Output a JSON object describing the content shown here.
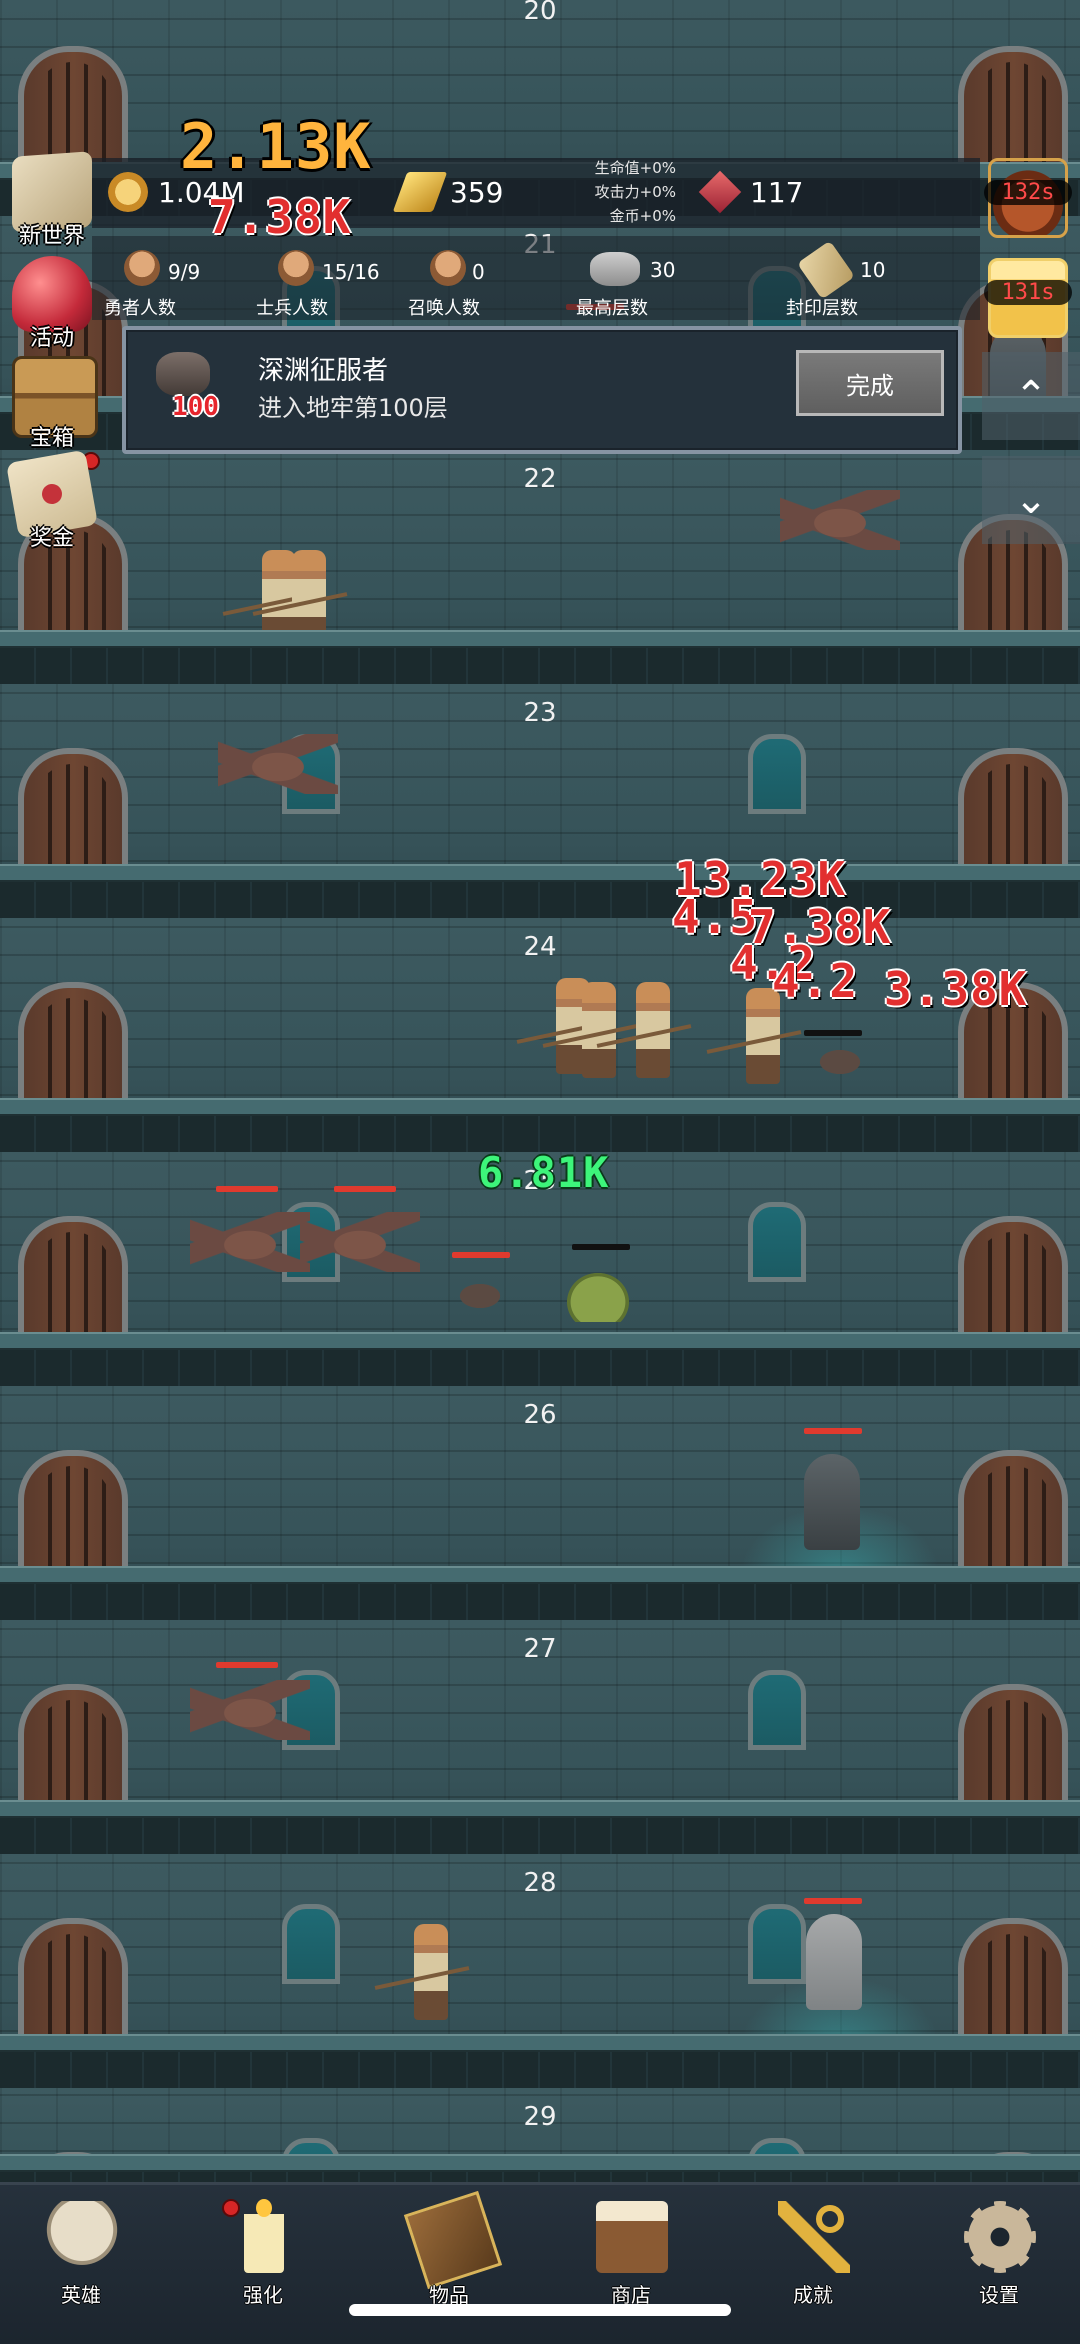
{
  "floors": [
    "20",
    "21",
    "22",
    "23",
    "24",
    "25",
    "26",
    "27",
    "28",
    "29"
  ],
  "resources": {
    "coin": "1.04M",
    "gold_bar": "359",
    "gem": "117",
    "buffs": [
      "生命值+0%",
      "攻击力+0%",
      "金币+0%"
    ]
  },
  "stats": {
    "heroes": {
      "value": "9/9",
      "label": "勇者人数"
    },
    "soldiers": {
      "value": "15/16",
      "label": "士兵人数"
    },
    "summons": {
      "value": "0",
      "label": "召唤人数"
    },
    "max_floor": {
      "value": "30",
      "label": "最高层数"
    },
    "sealed_floor": {
      "value": "10",
      "label": "封印层数"
    }
  },
  "quest": {
    "badge": "100",
    "title": "深渊征服者",
    "description": "进入地牢第100层",
    "button": "完成"
  },
  "left_menu": [
    {
      "label": "新世界",
      "icon": "map-icon"
    },
    {
      "label": "活动",
      "icon": "heart-icon"
    },
    {
      "label": "宝箱",
      "icon": "chest-icon"
    },
    {
      "label": "奖金",
      "icon": "letter-icon"
    }
  ],
  "right_timers": [
    {
      "time": "132s",
      "icon": "pot-icon"
    },
    {
      "time": "131s",
      "icon": "candle-icon"
    }
  ],
  "damage_numbers": [
    "2.13K",
    "7.38K",
    "13.23K",
    "4.5",
    "7.38K",
    "4.2",
    "4.2",
    "3.38K",
    "6.81K"
  ],
  "bottom_nav": [
    {
      "label": "英雄",
      "icon": "skull-icon"
    },
    {
      "label": "强化",
      "icon": "candle-icon"
    },
    {
      "label": "物品",
      "icon": "book-icon"
    },
    {
      "label": "商店",
      "icon": "mug-icon"
    },
    {
      "label": "成就",
      "icon": "key-icon"
    },
    {
      "label": "设置",
      "icon": "gear-icon"
    }
  ]
}
